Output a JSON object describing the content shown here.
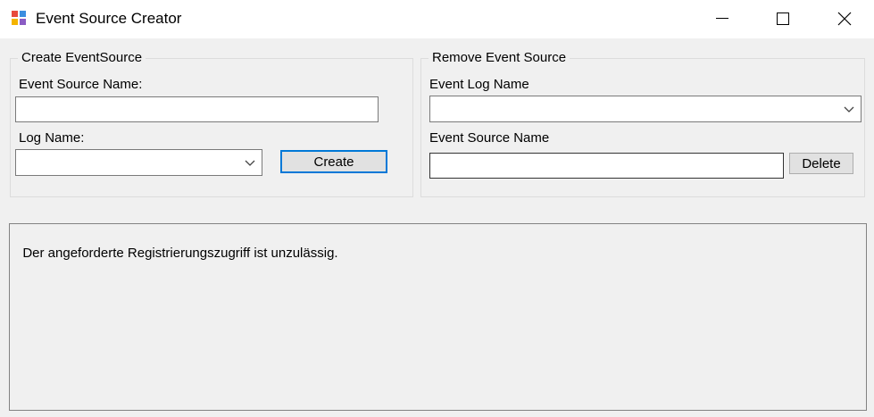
{
  "window": {
    "title": "Event Source Creator",
    "icon": "event-source-app-icon",
    "controls": [
      "minimize-icon",
      "maximize-icon",
      "close-icon"
    ]
  },
  "create_group": {
    "legend": "Create EventSource",
    "source_name_label": "Event Source Name:",
    "source_name_value": "",
    "log_name_label": "Log Name:",
    "log_name_value": "",
    "create_button": "Create"
  },
  "remove_group": {
    "legend": "Remove Event Source",
    "log_name_label": "Event Log Name",
    "log_name_value": "",
    "source_name_label": "Event Source Name",
    "source_name_value": "",
    "delete_button": "Delete"
  },
  "output": {
    "text": "Der angeforderte Registrierungszugriff ist unzulässig."
  },
  "colors": {
    "window_bg": "#f0f0f0",
    "titlebar_bg": "#ffffff",
    "focus_border": "#0078d7"
  }
}
